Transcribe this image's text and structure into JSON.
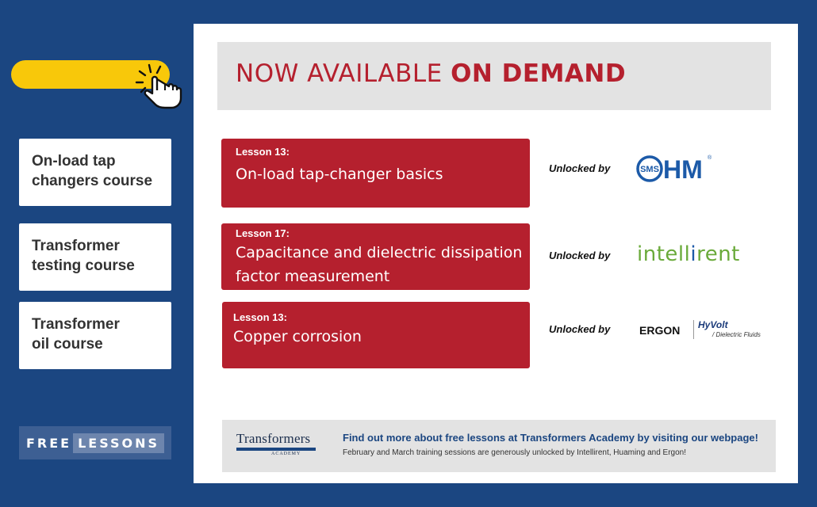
{
  "sidebar": {
    "courses": [
      {
        "label": "On-load tap\nchangers course"
      },
      {
        "label": "Transformer\ntesting course"
      },
      {
        "label": "Transformer\noil course"
      }
    ],
    "badge": {
      "word1": "FREE",
      "word2": "LESSONS"
    }
  },
  "header": {
    "title_light": "NOW AVAILABLE",
    "title_bold": "ON DEMAND"
  },
  "lessons": [
    {
      "number": "Lesson 13:",
      "title": "On-load tap-changer basics",
      "unlocked_label": "Unlocked by",
      "sponsor": "HM",
      "sponsor_emblem": "SMS",
      "sponsor_mark": "®"
    },
    {
      "number": "Lesson 17:",
      "title": "Capacitance and dielectric dissipation factor measurement",
      "unlocked_label": "Unlocked by",
      "sponsor_parts": [
        "intell",
        "i",
        "rent"
      ]
    },
    {
      "number": "Lesson 13:",
      "title": "Copper corrosion",
      "unlocked_label": "Unlocked by",
      "sponsor": "ERGON",
      "sponsor_brand": "HyVolt",
      "sponsor_tagline": "/ Dielectric Fluids"
    }
  ],
  "footer": {
    "logo_name": "Transformers",
    "logo_sub": "ACADEMY",
    "link_text": "Find out more about free lessons at Transformers Academy by visiting our webpage!",
    "note": "February and March training sessions are generously unlocked by Intellirent, Huaming and Ergon!"
  },
  "colors": {
    "background": "#1b4681",
    "accent_red": "#b5202e",
    "highlight_yellow": "#f8c80a",
    "sponsor_green": "#6aaa3a"
  },
  "icons": [
    "pointer-hand-icon"
  ]
}
